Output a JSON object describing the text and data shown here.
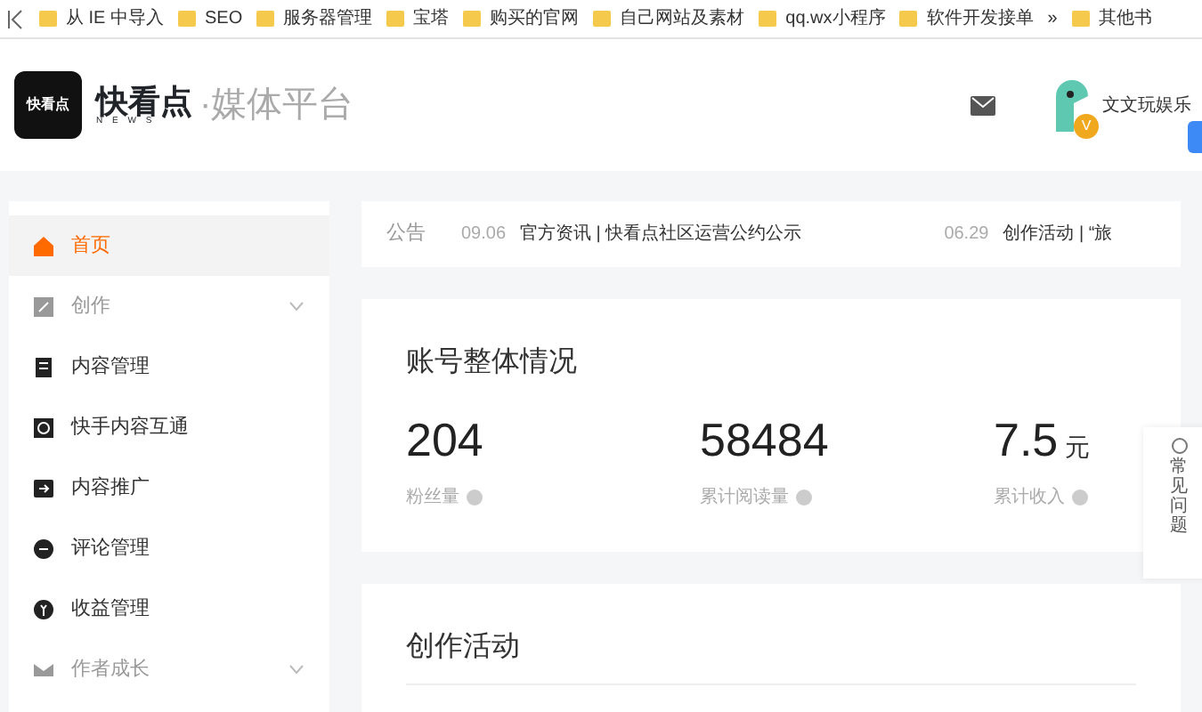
{
  "bookmarks": {
    "items": [
      "从 IE 中导入",
      "SEO",
      "服务器管理",
      "宝塔",
      "购买的官网",
      "自己网站及素材",
      "qq.wx小程序",
      "软件开发接单"
    ],
    "more": "»",
    "other": "其他书"
  },
  "header": {
    "logo_icon_text": "快看点",
    "logo_text": "快看点",
    "logo_sub": "N E W S",
    "platform": "·媒体平台",
    "username": "文文玩娱乐",
    "badge": "V"
  },
  "sidebar": {
    "items": [
      {
        "label": "首页",
        "kind": "home",
        "selected": true
      },
      {
        "label": "创作",
        "kind": "edit",
        "selected": false,
        "expanded": false,
        "disabled": true
      },
      {
        "label": "内容管理",
        "kind": "doc",
        "selected": false
      },
      {
        "label": "快手内容互通",
        "kind": "sync",
        "selected": false
      },
      {
        "label": "内容推广",
        "kind": "promo",
        "selected": false
      },
      {
        "label": "评论管理",
        "kind": "comment",
        "selected": false
      },
      {
        "label": "收益管理",
        "kind": "money",
        "selected": false
      },
      {
        "label": "作者成长",
        "kind": "grow",
        "selected": false,
        "expanded": false,
        "disabled": true
      }
    ]
  },
  "notice": {
    "label": "公告",
    "items": [
      {
        "date": "09.06",
        "text": "官方资讯 | 快看点社区运营公约公示"
      },
      {
        "date": "06.29",
        "text": "创作活动 |  “旅"
      }
    ]
  },
  "overview": {
    "title": "账号整体情况",
    "stats": [
      {
        "value": "204",
        "label": "粉丝量"
      },
      {
        "value": "58484",
        "label": "累计阅读量"
      },
      {
        "value": "7.5",
        "unit": "元",
        "label": "累计收入"
      }
    ]
  },
  "help": {
    "label": "常见问题"
  },
  "activity": {
    "title": "创作活动"
  }
}
